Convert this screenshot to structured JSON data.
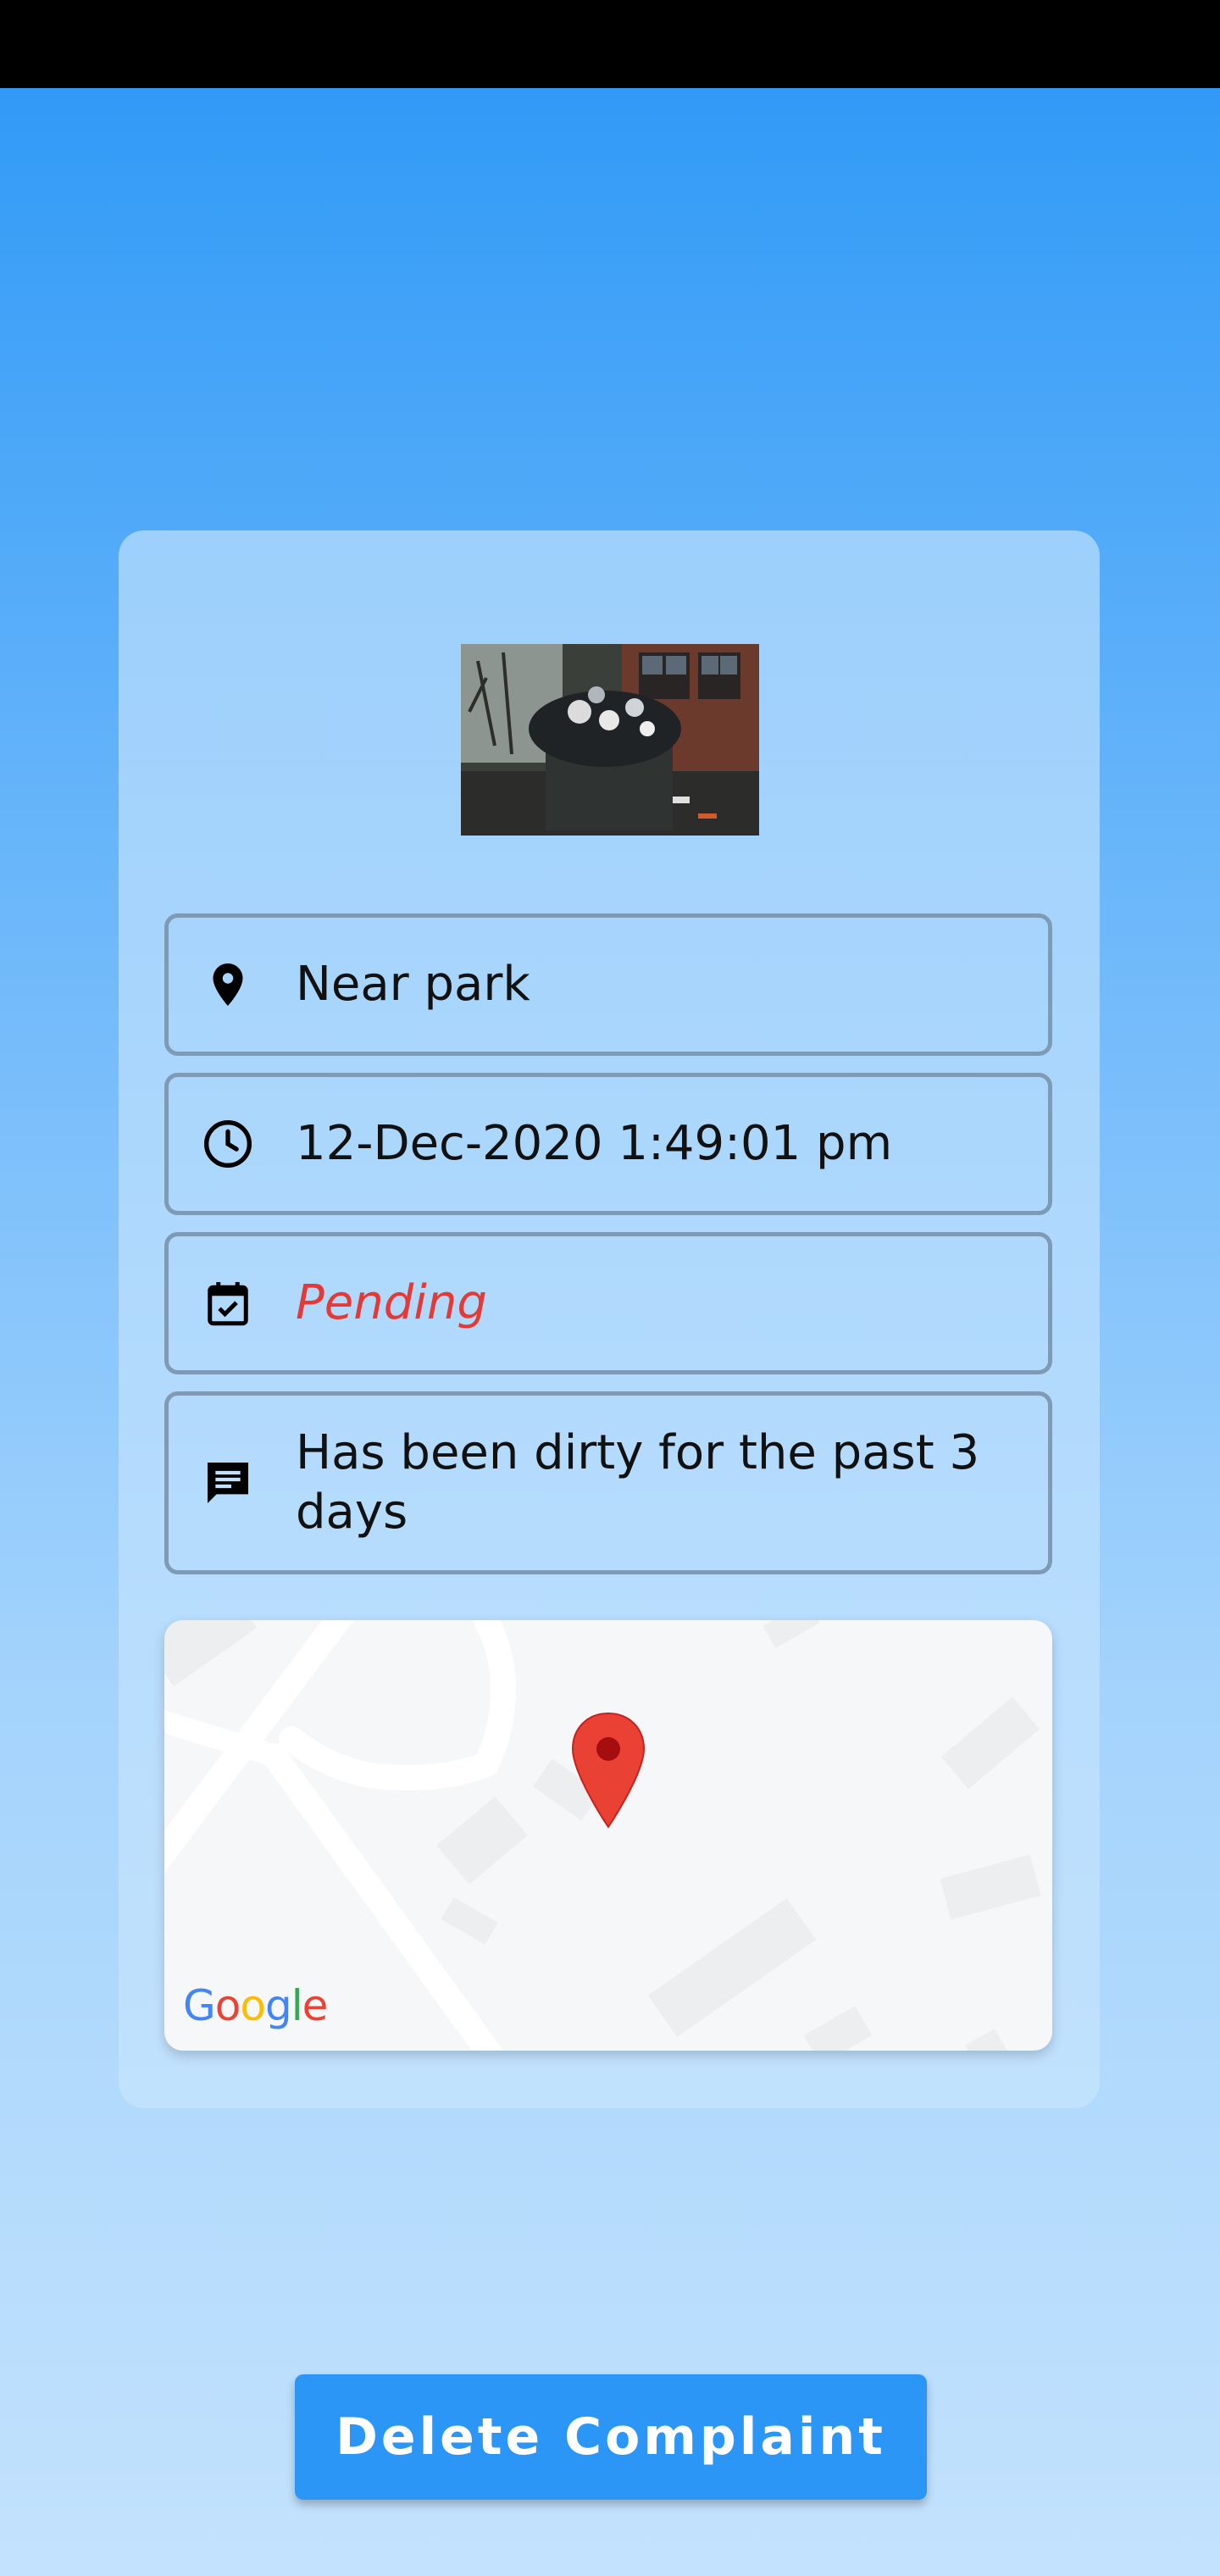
{
  "complaint": {
    "location": "Near park",
    "datetime": "12-Dec-2020 1:49:01 pm",
    "status": "Pending",
    "description": "Has been dirty for the past 3 days"
  },
  "map": {
    "attribution": "Google"
  },
  "actions": {
    "delete_label": "Delete Complaint"
  },
  "icons": {
    "location": "location-pin-icon",
    "datetime": "clock-icon",
    "status": "calendar-check-icon",
    "description": "comment-icon",
    "map_marker": "map-marker-icon"
  },
  "colors": {
    "accent": "#2b96f5",
    "status_pending": "#e53935"
  }
}
